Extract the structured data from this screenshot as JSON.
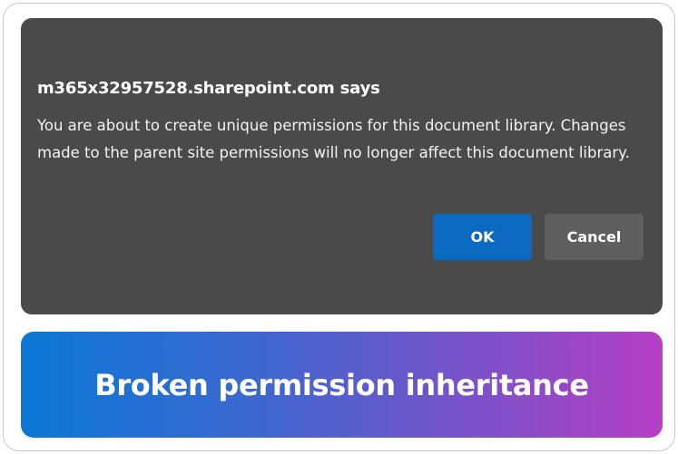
{
  "dialog": {
    "title": "m365x32957528.sharepoint.com says",
    "message": "You are about to create unique permissions for this document library. Changes made to the parent site permissions will no longer affect this document library.",
    "ok_label": "OK",
    "cancel_label": "Cancel"
  },
  "banner": {
    "text": "Broken permission inheritance"
  },
  "colors": {
    "dialog_background": "#4a4a4a",
    "ok_button": "#0b69c1",
    "cancel_button": "#5f5f5f",
    "banner_gradient_start": "#0a78d4",
    "banner_gradient_end": "#b53fc5"
  }
}
